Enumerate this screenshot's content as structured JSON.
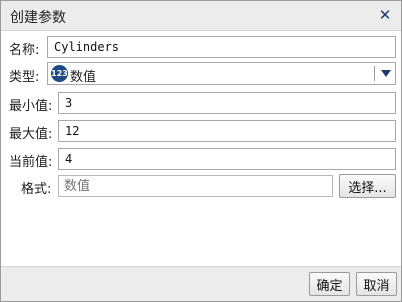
{
  "dialog": {
    "title": "创建参数"
  },
  "fields": {
    "name": {
      "label": "名称:",
      "value": "Cylinders"
    },
    "type": {
      "label": "类型:",
      "icon_text": "123",
      "value": "数值"
    },
    "min": {
      "label": "最小值:",
      "value": "3"
    },
    "max": {
      "label": "最大值:",
      "value": "12"
    },
    "current": {
      "label": "当前值:",
      "value": "4"
    },
    "format": {
      "label": "格式:",
      "placeholder": "数值",
      "select_label": "选择..."
    }
  },
  "buttons": {
    "ok": "确定",
    "cancel": "取消"
  },
  "icons": {
    "close": "close-icon",
    "type": "numeric-type-icon",
    "dropdown": "chevron-down-icon"
  },
  "colors": {
    "accent": "#1f3b6e",
    "type_icon_bg": "#1f4a86"
  }
}
